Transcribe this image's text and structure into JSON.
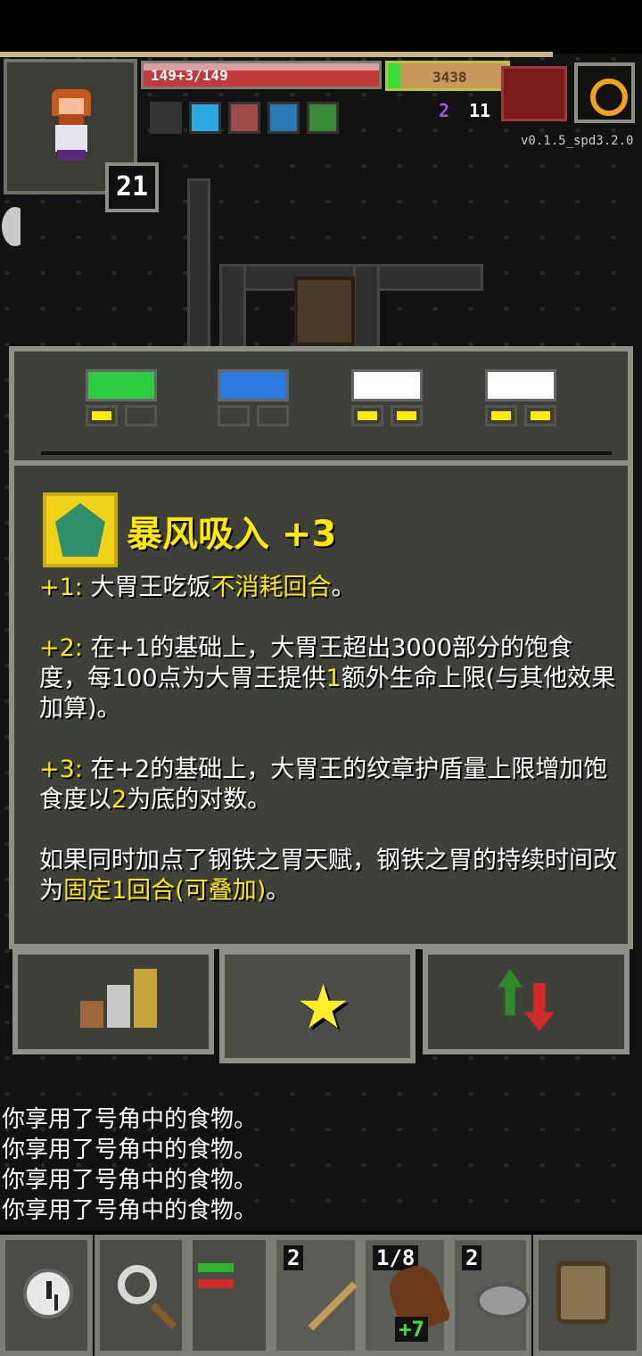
{
  "status": {
    "hp_text": "149+3/149",
    "exp_value": "3438",
    "level": "21",
    "keys": "2",
    "gold": "11",
    "version": "v0.1.5_spd3.2.0",
    "hp_fraction": 1.0,
    "exp_fraction": 0.1
  },
  "buffs": [
    {
      "icon": "dark-buff-icon",
      "color": "#333333"
    },
    {
      "icon": "skull-buff-icon",
      "color": "#2aa8e0"
    },
    {
      "icon": "upgrade-buff-icon",
      "color": "#a04a4a"
    },
    {
      "icon": "shield-buff-icon",
      "color": "#2a7ab5"
    },
    {
      "icon": "rest-buff-icon",
      "color": "#3a8a3a"
    }
  ],
  "talents": [
    {
      "icon": "heart-talent-icon",
      "color": "#2ecc40",
      "pips": [
        true,
        false
      ]
    },
    {
      "icon": "scroll-talent-icon",
      "color": "#2a7ae0",
      "pips": [
        false,
        false
      ]
    },
    {
      "icon": "armor-talent-icon",
      "color": "#ffffff",
      "pips": [
        true,
        true
      ]
    },
    {
      "icon": "cloth-talent-icon",
      "color": "#ffffff",
      "pips": [
        true,
        true
      ]
    }
  ],
  "info": {
    "title": "暴风吸入 +3",
    "line1_prefix": "+1: ",
    "line1_text": "大胃王吃饭",
    "line1_hl": "不消耗回合",
    "line1_end": "。",
    "line2_prefix": "+2: ",
    "line2_text_a": "在+1的基础上，大胃王超出3000部分的饱食度，每100点为大胃王提供",
    "line2_hl": "1",
    "line2_text_b": "额外生命上限(与其他效果加算)。",
    "line3_prefix": "+3: ",
    "line3_text_a": "在+2的基础上，大胃王的纹章护盾量上限增加饱食度以",
    "line3_hl": "2",
    "line3_text_b": "为底的对数。",
    "line4_text": "如果同时加点了钢铁之胃天赋，钢铁之胃的持续时间改为",
    "line4_hl": "固定1回合(可叠加)",
    "line4_end": "。"
  },
  "tabs": [
    {
      "icon": "stats-bars-icon"
    },
    {
      "icon": "star-icon"
    },
    {
      "icon": "updown-arrows-icon"
    }
  ],
  "log": [
    "你享用了号角中的食物。",
    "你享用了号角中的食物。",
    "你享用了号角中的食物。",
    "你享用了号角中的食物。"
  ],
  "toolbar": {
    "dart_count": "2",
    "horn_count": "1/8",
    "horn_bonus": "+7",
    "stone_count": "2"
  }
}
